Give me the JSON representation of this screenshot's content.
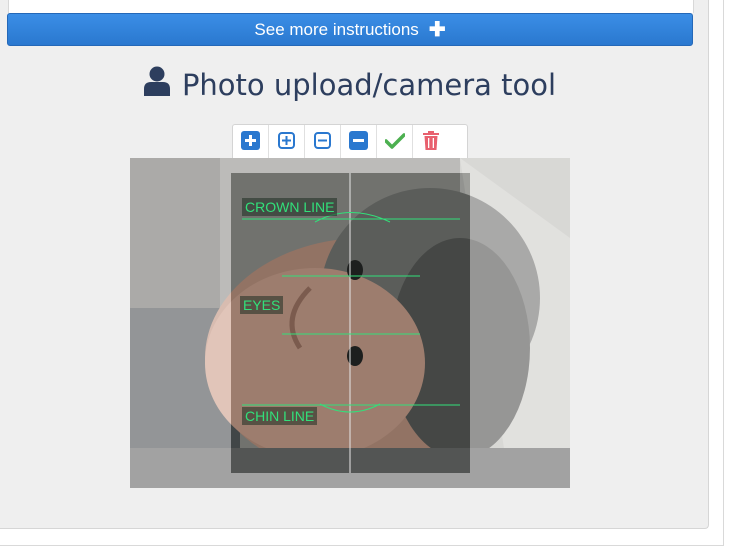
{
  "instructions": {
    "more_label": "See more instructions"
  },
  "tool": {
    "title": "Photo upload/camera tool"
  },
  "toolbar": {
    "buttons": [
      {
        "name": "zoom-in-button"
      },
      {
        "name": "zoom-in-outline-button"
      },
      {
        "name": "zoom-out-outline-button"
      },
      {
        "name": "zoom-out-button"
      },
      {
        "name": "confirm-button"
      },
      {
        "name": "delete-button"
      }
    ]
  },
  "guides": {
    "crown": "CROWN LINE",
    "eyes": "EYES",
    "chin": "CHIN LINE"
  },
  "colors": {
    "accent": "#2a78cf",
    "guide": "#32e07a",
    "confirm": "#4cb050",
    "delete": "#e8606e",
    "title": "#2d3e5e"
  }
}
